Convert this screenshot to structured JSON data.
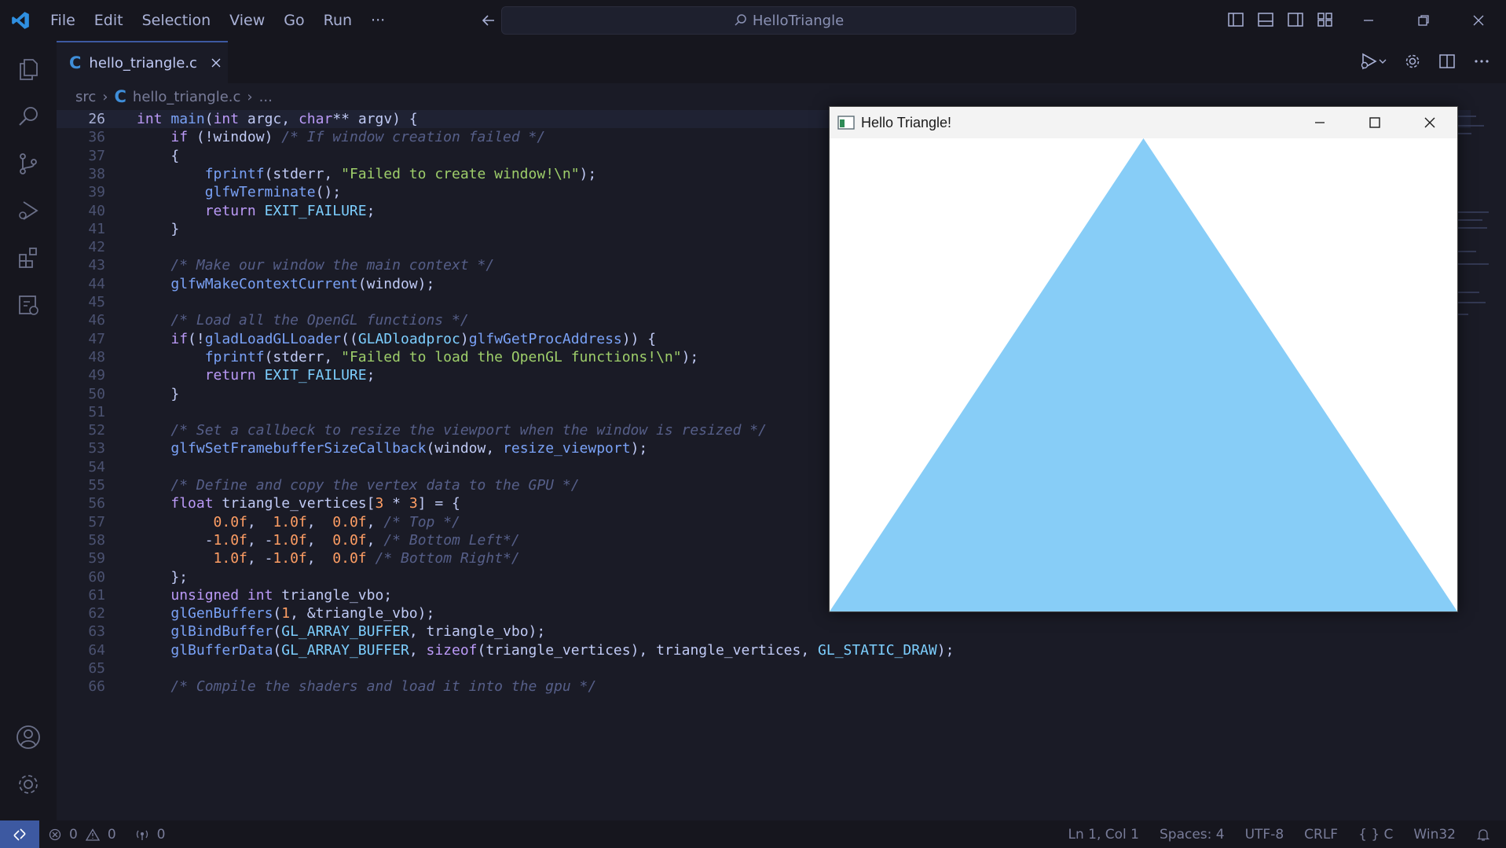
{
  "app": {
    "menu": [
      "File",
      "Edit",
      "Selection",
      "View",
      "Go",
      "Run",
      "···"
    ],
    "search_text": "HelloTriangle"
  },
  "tab": {
    "filename": "hello_triangle.c",
    "lang_glyph": "C"
  },
  "breadcrumb": {
    "folder": "src",
    "file": "hello_triangle.c",
    "ellipsis": "..."
  },
  "editor": {
    "lines": [
      {
        "n": "26",
        "sticky": true,
        "tokens": [
          [
            "kw",
            "int "
          ],
          [
            "fn",
            "main"
          ],
          [
            "plain",
            "("
          ],
          [
            "kw",
            "int "
          ],
          [
            "plain",
            "argc, "
          ],
          [
            "kw",
            "char"
          ],
          [
            "plain",
            "** argv) {"
          ]
        ]
      },
      {
        "n": "36",
        "tokens": [
          [
            "plain",
            "    "
          ],
          [
            "kw",
            "if "
          ],
          [
            "plain",
            "(!window) "
          ],
          [
            "cmt",
            "/* If window creation failed */"
          ]
        ]
      },
      {
        "n": "37",
        "tokens": [
          [
            "plain",
            "    {"
          ]
        ]
      },
      {
        "n": "38",
        "tokens": [
          [
            "plain",
            "        "
          ],
          [
            "fn",
            "fprintf"
          ],
          [
            "plain",
            "(stderr, "
          ],
          [
            "str",
            "\"Failed to create window!\\n\""
          ],
          [
            "plain",
            ");"
          ]
        ]
      },
      {
        "n": "39",
        "tokens": [
          [
            "plain",
            "        "
          ],
          [
            "fn",
            "glfwTerminate"
          ],
          [
            "plain",
            "();"
          ]
        ]
      },
      {
        "n": "40",
        "tokens": [
          [
            "plain",
            "        "
          ],
          [
            "kw",
            "return "
          ],
          [
            "const",
            "EXIT_FAILURE"
          ],
          [
            "plain",
            ";"
          ]
        ]
      },
      {
        "n": "41",
        "tokens": [
          [
            "plain",
            "    }"
          ]
        ]
      },
      {
        "n": "42",
        "tokens": []
      },
      {
        "n": "43",
        "tokens": [
          [
            "plain",
            "    "
          ],
          [
            "cmt",
            "/* Make our window the main context */"
          ]
        ]
      },
      {
        "n": "44",
        "tokens": [
          [
            "plain",
            "    "
          ],
          [
            "fn",
            "glfwMakeContextCurrent"
          ],
          [
            "plain",
            "(window);"
          ]
        ]
      },
      {
        "n": "45",
        "tokens": []
      },
      {
        "n": "46",
        "tokens": [
          [
            "plain",
            "    "
          ],
          [
            "cmt",
            "/* Load all the OpenGL functions */"
          ]
        ]
      },
      {
        "n": "47",
        "tokens": [
          [
            "plain",
            "    "
          ],
          [
            "kw",
            "if"
          ],
          [
            "plain",
            "(!"
          ],
          [
            "fn",
            "gladLoadGLLoader"
          ],
          [
            "plain",
            "(("
          ],
          [
            "const",
            "GLADloadproc"
          ],
          [
            "plain",
            ")"
          ],
          [
            "fn",
            "glfwGetProcAddress"
          ],
          [
            "plain",
            ")) {"
          ]
        ]
      },
      {
        "n": "48",
        "tokens": [
          [
            "plain",
            "        "
          ],
          [
            "fn",
            "fprintf"
          ],
          [
            "plain",
            "(stderr, "
          ],
          [
            "str",
            "\"Failed to load the OpenGL functions!\\n\""
          ],
          [
            "plain",
            ");"
          ]
        ]
      },
      {
        "n": "49",
        "tokens": [
          [
            "plain",
            "        "
          ],
          [
            "kw",
            "return "
          ],
          [
            "const",
            "EXIT_FAILURE"
          ],
          [
            "plain",
            ";"
          ]
        ]
      },
      {
        "n": "50",
        "tokens": [
          [
            "plain",
            "    }"
          ]
        ]
      },
      {
        "n": "51",
        "tokens": []
      },
      {
        "n": "52",
        "tokens": [
          [
            "plain",
            "    "
          ],
          [
            "cmt",
            "/* Set a callbeck to resize the viewport when the window is resized */"
          ]
        ]
      },
      {
        "n": "53",
        "tokens": [
          [
            "plain",
            "    "
          ],
          [
            "fn",
            "glfwSetFramebufferSizeCallback"
          ],
          [
            "plain",
            "(window, "
          ],
          [
            "fn",
            "resize_viewport"
          ],
          [
            "plain",
            ");"
          ]
        ]
      },
      {
        "n": "54",
        "tokens": []
      },
      {
        "n": "55",
        "tokens": [
          [
            "plain",
            "    "
          ],
          [
            "cmt",
            "/* Define and copy the vertex data to the GPU */"
          ]
        ]
      },
      {
        "n": "56",
        "tokens": [
          [
            "plain",
            "    "
          ],
          [
            "kw",
            "float "
          ],
          [
            "plain",
            "triangle_vertices["
          ],
          [
            "num",
            "3"
          ],
          [
            "plain",
            " * "
          ],
          [
            "num",
            "3"
          ],
          [
            "plain",
            "] = {"
          ]
        ]
      },
      {
        "n": "57",
        "tokens": [
          [
            "plain",
            "         "
          ],
          [
            "num",
            "0.0f"
          ],
          [
            "plain",
            ",  "
          ],
          [
            "num",
            "1.0f"
          ],
          [
            "plain",
            ",  "
          ],
          [
            "num",
            "0.0f"
          ],
          [
            "plain",
            ", "
          ],
          [
            "cmt",
            "/* Top */"
          ]
        ]
      },
      {
        "n": "58",
        "tokens": [
          [
            "plain",
            "        -"
          ],
          [
            "num",
            "1.0f"
          ],
          [
            "plain",
            ", -"
          ],
          [
            "num",
            "1.0f"
          ],
          [
            "plain",
            ",  "
          ],
          [
            "num",
            "0.0f"
          ],
          [
            "plain",
            ", "
          ],
          [
            "cmt",
            "/* Bottom Left*/"
          ]
        ]
      },
      {
        "n": "59",
        "tokens": [
          [
            "plain",
            "         "
          ],
          [
            "num",
            "1.0f"
          ],
          [
            "plain",
            ", -"
          ],
          [
            "num",
            "1.0f"
          ],
          [
            "plain",
            ",  "
          ],
          [
            "num",
            "0.0f"
          ],
          [
            "plain",
            " "
          ],
          [
            "cmt",
            "/* Bottom Right*/"
          ]
        ]
      },
      {
        "n": "60",
        "tokens": [
          [
            "plain",
            "    };"
          ]
        ]
      },
      {
        "n": "61",
        "tokens": [
          [
            "plain",
            "    "
          ],
          [
            "kw",
            "unsigned int "
          ],
          [
            "plain",
            "triangle_vbo;"
          ]
        ]
      },
      {
        "n": "62",
        "tokens": [
          [
            "plain",
            "    "
          ],
          [
            "fn",
            "glGenBuffers"
          ],
          [
            "plain",
            "("
          ],
          [
            "num",
            "1"
          ],
          [
            "plain",
            ", &triangle_vbo);"
          ]
        ]
      },
      {
        "n": "63",
        "tokens": [
          [
            "plain",
            "    "
          ],
          [
            "fn",
            "glBindBuffer"
          ],
          [
            "plain",
            "("
          ],
          [
            "const",
            "GL_ARRAY_BUFFER"
          ],
          [
            "plain",
            ", triangle_vbo);"
          ]
        ]
      },
      {
        "n": "64",
        "tokens": [
          [
            "plain",
            "    "
          ],
          [
            "fn",
            "glBufferData"
          ],
          [
            "plain",
            "("
          ],
          [
            "const",
            "GL_ARRAY_BUFFER"
          ],
          [
            "plain",
            ", "
          ],
          [
            "kw",
            "sizeof"
          ],
          [
            "plain",
            "(triangle_vertices), triangle_vertices, "
          ],
          [
            "const",
            "GL_STATIC_DRAW"
          ],
          [
            "plain",
            ");"
          ]
        ]
      },
      {
        "n": "65",
        "tokens": []
      },
      {
        "n": "66",
        "tokens": [
          [
            "plain",
            "    "
          ],
          [
            "cmt",
            "/* Compile the shaders and load it into the gpu */"
          ]
        ]
      }
    ]
  },
  "gl_window": {
    "title": "Hello Triangle!",
    "triangle_color": "#87cdf7"
  },
  "status": {
    "errors": "0",
    "warnings": "0",
    "ports": "0",
    "position": "Ln 1, Col 1",
    "spaces": "Spaces: 4",
    "encoding": "UTF-8",
    "eol": "CRLF",
    "language": "C",
    "config": "Win32"
  },
  "colors": {
    "accent": "#3d59a1",
    "bg": "#1a1b26",
    "chrome": "#16161e"
  }
}
